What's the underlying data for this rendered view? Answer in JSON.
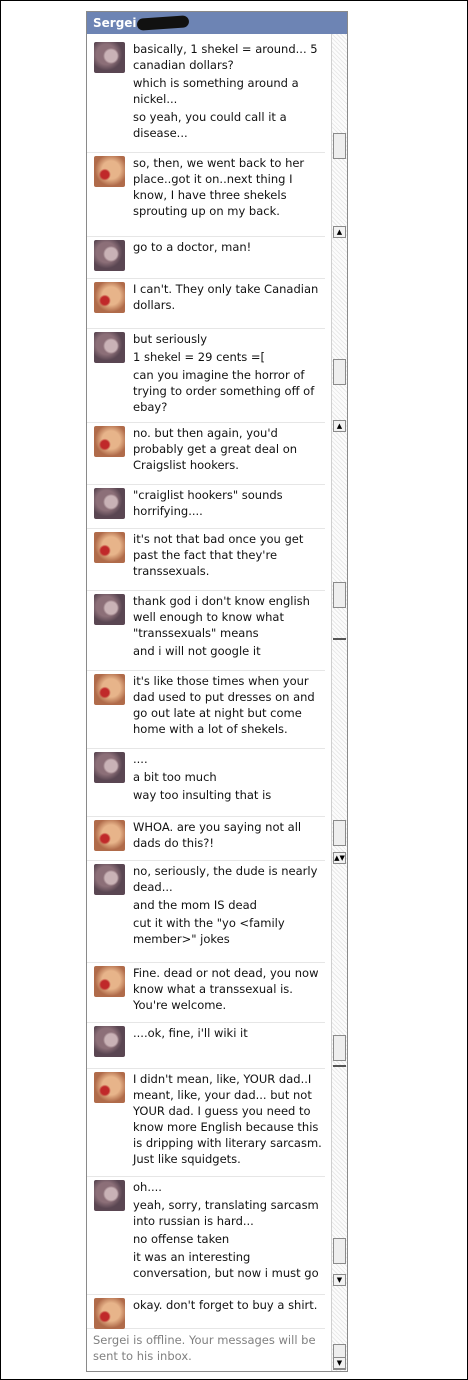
{
  "window": {
    "title": "Sergei"
  },
  "messages": [
    {
      "sender": "sergei",
      "lines": [
        "basically, 1 shekel = around... 5 canadian dollars?",
        "which is something around a nickel...",
        "so yeah, you could call it a disease..."
      ]
    },
    {
      "sender": "other",
      "lines": [
        "so, then, we went back to her place..got it on..next thing I know, I have three shekels sprouting up on my back."
      ]
    },
    {
      "sender": "sergei",
      "lines": [
        "go to a doctor, man!"
      ]
    },
    {
      "sender": "other",
      "lines": [
        "I can't. They only take Canadian dollars."
      ]
    },
    {
      "sender": "sergei",
      "lines": [
        "but seriously",
        "1 shekel = 29 cents =[",
        "can you imagine the horror of trying to order something off of ebay?"
      ]
    },
    {
      "sender": "other",
      "lines": [
        "no. but then again, you'd probably get a great deal on Craigslist hookers."
      ]
    },
    {
      "sender": "sergei",
      "lines": [
        "\"craiglist hookers\" sounds horrifying...."
      ]
    },
    {
      "sender": "other",
      "lines": [
        "it's not that bad once you get past the fact that they're transsexuals."
      ]
    },
    {
      "sender": "sergei",
      "lines": [
        "thank god i don't know english well enough to know what \"transsexuals\" means",
        "and i will not google it"
      ]
    },
    {
      "sender": "other",
      "lines": [
        "it's like those times when your dad used to put dresses on and go out late at night but come home with a lot of shekels."
      ]
    },
    {
      "sender": "sergei",
      "lines": [
        "....",
        "a bit too much",
        "way too insulting that is"
      ]
    },
    {
      "sender": "other",
      "lines": [
        "WHOA. are you saying not all dads do this?!"
      ]
    },
    {
      "sender": "sergei",
      "lines": [
        "no, seriously, the dude is nearly dead...",
        "and the mom IS dead",
        "cut it with the \"yo <family member>\" jokes"
      ]
    },
    {
      "sender": "other",
      "lines": [
        "Fine. dead or not dead, you now know what a transsexual is. You're welcome."
      ]
    },
    {
      "sender": "sergei",
      "lines": [
        "....ok, fine, i'll wiki it"
      ]
    },
    {
      "sender": "other",
      "lines": [
        "I didn't mean, like, YOUR dad..I meant, like, your dad... but not YOUR dad. I guess you need to know more English because this is dripping with literary sarcasm. Just like squidgets."
      ]
    },
    {
      "sender": "sergei",
      "lines": [
        "oh....",
        "yeah, sorry, translating sarcasm into russian is hard...",
        "no offense taken",
        "it was an interesting conversation, but now i must go"
      ]
    },
    {
      "sender": "other",
      "lines": [
        "okay. don't forget to buy a shirt."
      ]
    }
  ],
  "status": {
    "offline_notice": "Sergei is offline. Your messages will be sent to his inbox."
  },
  "colors": {
    "titlebar": "#6d84b4",
    "text": "#111111",
    "muted": "#808080"
  }
}
